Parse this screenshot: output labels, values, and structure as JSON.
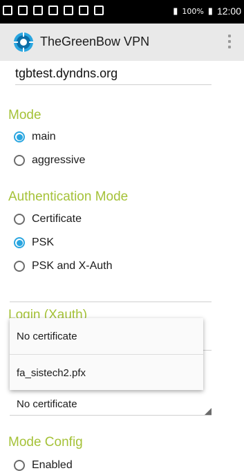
{
  "status_bar": {
    "battery_pct": "100%",
    "time": "12:00",
    "icons": [
      "tools-icon",
      "wrench-icon",
      "image-icon",
      "device-icon",
      "camera-icon",
      "gmail-icon",
      "mail-icon",
      "signal-icon",
      "battery-icon"
    ]
  },
  "action_bar": {
    "title": "TheGreenBow VPN"
  },
  "form": {
    "host_value": "tgbtest.dyndns.org",
    "mode": {
      "title": "Mode",
      "options": [
        {
          "label": "main",
          "selected": true
        },
        {
          "label": "aggressive",
          "selected": false
        }
      ]
    },
    "auth_mode": {
      "title": "Authentication Mode",
      "options": [
        {
          "label": "Certificate",
          "selected": false
        },
        {
          "label": "PSK",
          "selected": true
        },
        {
          "label": "PSK and X-Auth",
          "selected": false
        }
      ]
    },
    "login_title": "Login (Xauth)",
    "certificate_spinner_value": "No certificate",
    "popup_options": [
      "No certificate",
      "fa_sistech2.pfx"
    ],
    "mode_config": {
      "title": "Mode Config",
      "options": [
        {
          "label": "Enabled",
          "selected": false
        }
      ]
    }
  },
  "colors": {
    "accent_green": "#a5c238",
    "radio_blue": "#2aa6e0",
    "action_bar_bg": "#e9e9e9"
  }
}
